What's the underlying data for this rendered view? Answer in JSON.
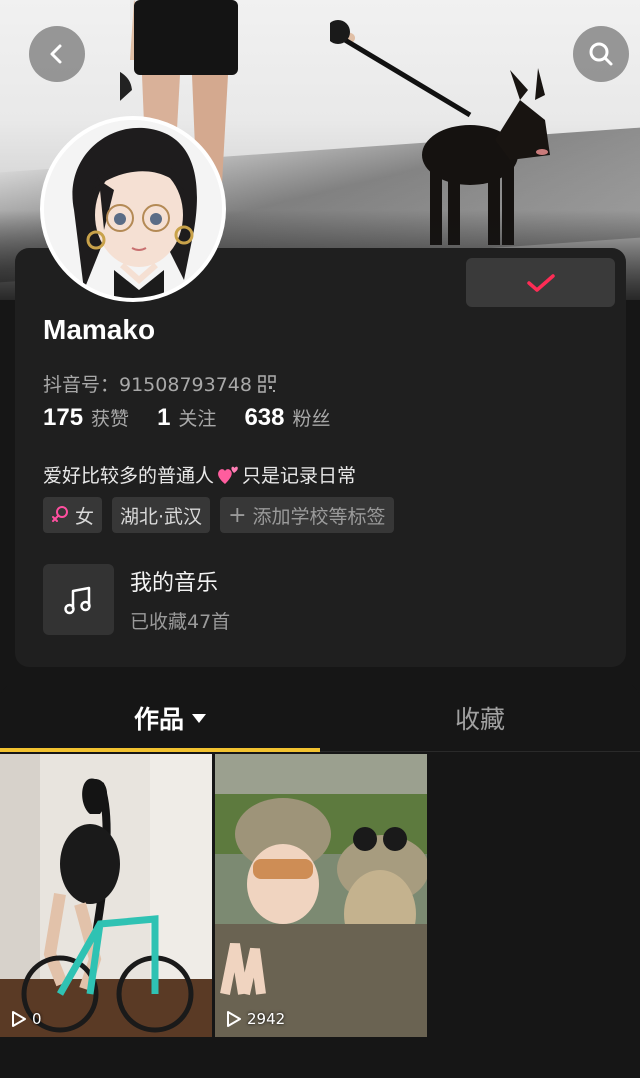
{
  "header": {
    "back_icon": "chevron-left-icon",
    "search_icon": "search-icon"
  },
  "profile": {
    "name": "Mamako",
    "douyin_id": "抖音号：91508793748",
    "stats": [
      {
        "num": "175",
        "label": "获赞"
      },
      {
        "num": "1",
        "label": "关注"
      },
      {
        "num": "638",
        "label": "粉丝"
      }
    ],
    "bio_before": "爱好比较多的普通人",
    "bio_after": "只是记录日常",
    "tags": [
      {
        "label": "女",
        "icon": "female-icon"
      },
      {
        "label": "湖北·武汉"
      },
      {
        "label": "添加学校等标签",
        "icon": "plus-icon"
      }
    ],
    "music": {
      "title": "我的音乐",
      "subtitle": "已收藏47首"
    },
    "follow_state": "followed",
    "colors": {
      "accent": "#fe2c55",
      "tab_indicator": "#f2c230",
      "card_bg": "#1f1f1f"
    }
  },
  "tabs": [
    {
      "label": "作品",
      "active": true
    },
    {
      "label": "收藏",
      "active": false
    }
  ],
  "videos": [
    {
      "plays": "0",
      "icon": "play-icon"
    },
    {
      "plays": "2942",
      "icon": "play-icon"
    }
  ]
}
